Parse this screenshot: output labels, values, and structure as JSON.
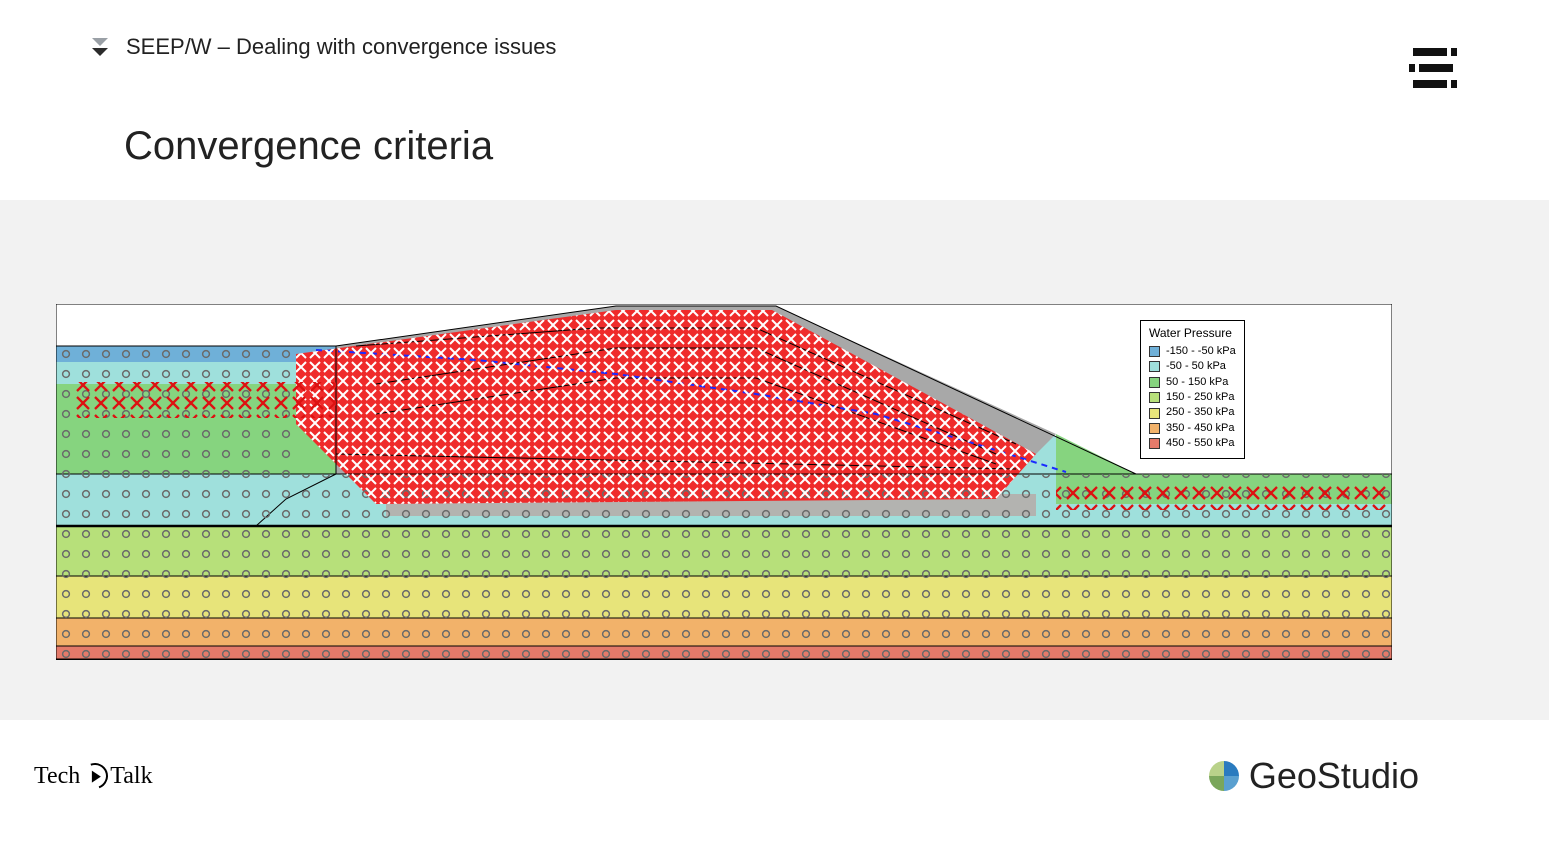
{
  "header": {
    "text": "SEEP/W – Dealing with convergence issues"
  },
  "title": "Convergence criteria",
  "legend": {
    "title": "Water Pressure",
    "items": [
      {
        "label": "-150 - -50 kPa",
        "color": "#6fb0d8"
      },
      {
        "label": "-50 - 50 kPa",
        "color": "#9fe0dc"
      },
      {
        "label": "50 - 150 kPa",
        "color": "#86d47f"
      },
      {
        "label": "150 - 250 kPa",
        "color": "#b7e07a"
      },
      {
        "label": "250 - 350 kPa",
        "color": "#e7e47a"
      },
      {
        "label": "350 - 450 kPa",
        "color": "#f2b26a"
      },
      {
        "label": "450 - 550 kPa",
        "color": "#e47a6a"
      }
    ]
  },
  "footer": {
    "techtalk_left": "Tech",
    "techtalk_right": "Talk",
    "brand": "GeoStudio"
  },
  "chart_data": {
    "type": "area",
    "title": "Convergence criteria node map (dam cross-section, water pressure contours)",
    "xlabel": "",
    "ylabel": "",
    "x_range": [
      0,
      1336
    ],
    "y_range": [
      0,
      356
    ],
    "pressure_bands_kPa": [
      -150,
      -50,
      50,
      150,
      250,
      350,
      450,
      550
    ],
    "band_colors": [
      "#6fb0d8",
      "#9fe0dc",
      "#86d47f",
      "#b7e07a",
      "#e7e47a",
      "#f2b26a",
      "#e47a6a"
    ],
    "markers": {
      "converged": "open grey circle",
      "unconverged": "red x",
      "grey_fill": "grey solid"
    },
    "unconverged_region_desc": "Dense red x cluster across upper embankment/core between x≈220 and x≈1010, y≈0–200; scattered red x along right toe y≈170–190",
    "phreatic_line_desc": "Blue dashed line descending from upper-left crest across dam body to right toe"
  }
}
